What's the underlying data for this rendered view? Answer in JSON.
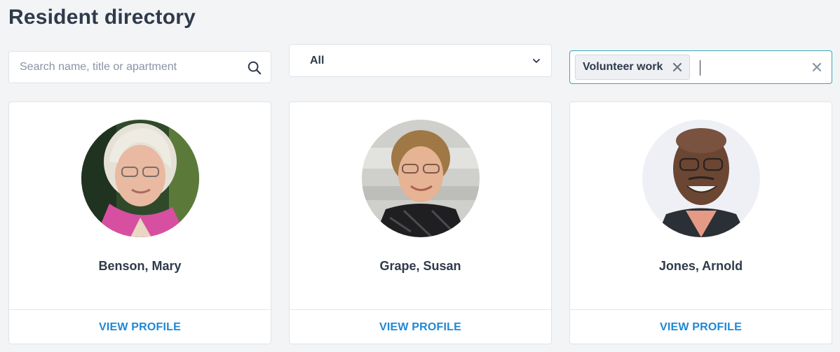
{
  "page": {
    "title": "Resident directory"
  },
  "filters": {
    "search": {
      "placeholder": "Search name, title or apartment",
      "value": "",
      "icon": "search-icon"
    },
    "category_select": {
      "selected": "All",
      "icon": "chevron-down-icon"
    },
    "tags_input": {
      "tags": [
        {
          "label": "Volunteer work"
        }
      ],
      "accent_color": "#3aa6b4"
    }
  },
  "residents": [
    {
      "name": "Benson, Mary",
      "action_label": "VIEW PROFILE"
    },
    {
      "name": "Grape, Susan",
      "action_label": "VIEW PROFILE"
    },
    {
      "name": "Jones, Arnold",
      "action_label": "VIEW PROFILE"
    }
  ],
  "colors": {
    "link": "#1e88d6",
    "background": "#f3f4f6"
  }
}
